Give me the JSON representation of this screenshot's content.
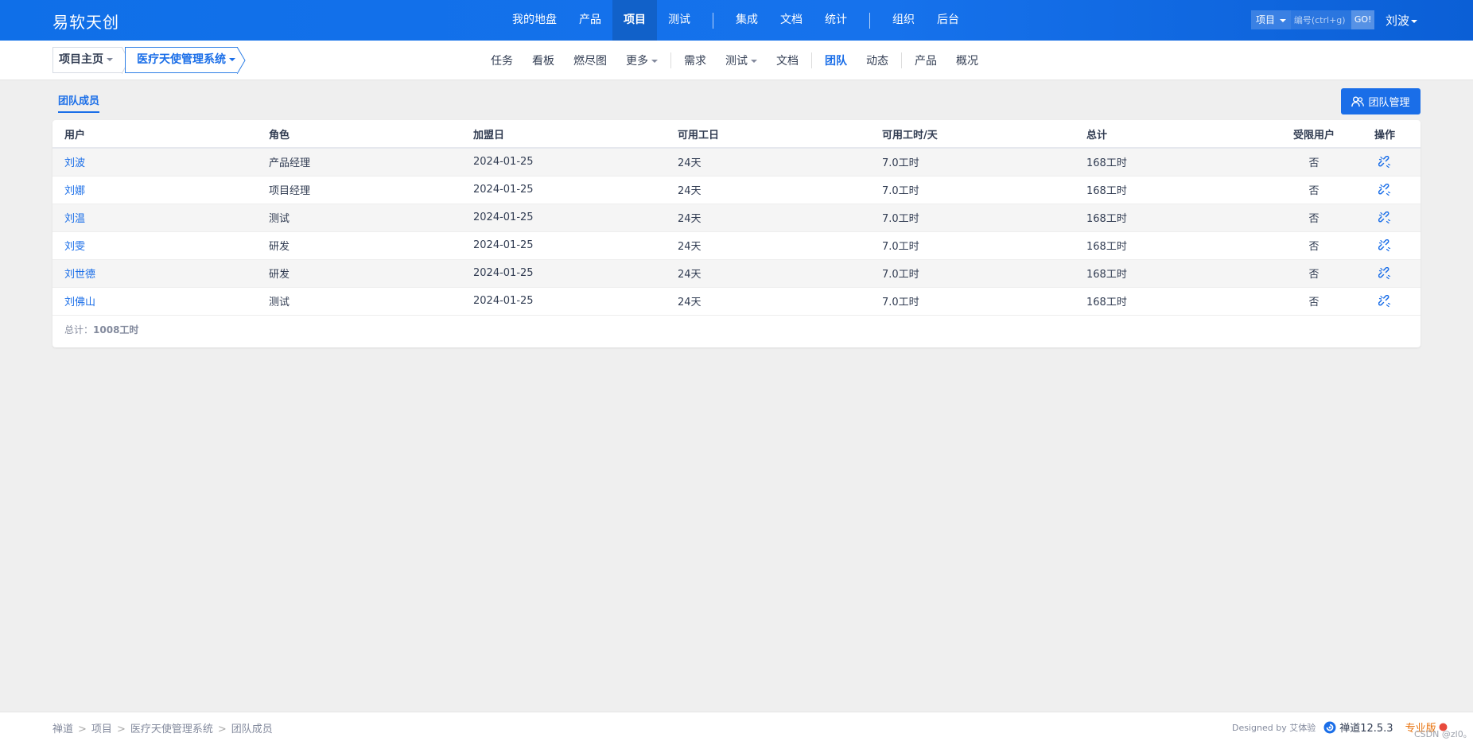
{
  "colors": {
    "brand": "#1672ec",
    "link": "#1a6ee8",
    "pro": "#e8720c"
  },
  "header": {
    "brand": "易软天创",
    "nav": [
      {
        "label": "我的地盘",
        "active": false
      },
      {
        "label": "产品",
        "active": false
      },
      {
        "label": "项目",
        "active": true
      },
      {
        "label": "测试",
        "active": false
      },
      {
        "label": "集成",
        "active": false
      },
      {
        "label": "文档",
        "active": false
      },
      {
        "label": "统计",
        "active": false
      },
      {
        "label": "组织",
        "active": false
      },
      {
        "label": "后台",
        "active": false
      }
    ],
    "search": {
      "type": "项目",
      "placeholder": "编号(ctrl+g)",
      "go": "GO!"
    },
    "user": "刘波"
  },
  "subheader": {
    "crumb_home": "项目主页",
    "crumb_project": "医疗天使管理系统",
    "nav": [
      {
        "label": "任务",
        "active": false
      },
      {
        "label": "看板",
        "active": false
      },
      {
        "label": "燃尽图",
        "active": false
      },
      {
        "label": "更多",
        "active": false
      },
      {
        "label": "需求",
        "active": false
      },
      {
        "label": "测试",
        "active": false
      },
      {
        "label": "文档",
        "active": false
      },
      {
        "label": "团队",
        "active": true
      },
      {
        "label": "动态",
        "active": false
      },
      {
        "label": "产品",
        "active": false
      },
      {
        "label": "概况",
        "active": false
      }
    ]
  },
  "main": {
    "tab": "团队成员",
    "manage_button": "团队管理",
    "table": {
      "headers": [
        "用户",
        "角色",
        "加盟日",
        "可用工日",
        "可用工时/天",
        "总计",
        "受限用户",
        "操作"
      ],
      "rows": [
        {
          "user": "刘波",
          "role": "产品经理",
          "join": "2024-01-25",
          "days": "24天",
          "hours": "7.0工时",
          "total": "168工时",
          "limited": "否"
        },
        {
          "user": "刘娜",
          "role": "项目经理",
          "join": "2024-01-25",
          "days": "24天",
          "hours": "7.0工时",
          "total": "168工时",
          "limited": "否"
        },
        {
          "user": "刘温",
          "role": "测试",
          "join": "2024-01-25",
          "days": "24天",
          "hours": "7.0工时",
          "total": "168工时",
          "limited": "否"
        },
        {
          "user": "刘雯",
          "role": "研发",
          "join": "2024-01-25",
          "days": "24天",
          "hours": "7.0工时",
          "total": "168工时",
          "limited": "否"
        },
        {
          "user": "刘世德",
          "role": "研发",
          "join": "2024-01-25",
          "days": "24天",
          "hours": "7.0工时",
          "total": "168工时",
          "limited": "否"
        },
        {
          "user": "刘佛山",
          "role": "测试",
          "join": "2024-01-25",
          "days": "24天",
          "hours": "7.0工时",
          "total": "168工时",
          "limited": "否"
        }
      ],
      "row_action_icon": "unlink-icon"
    },
    "summary_label": "总计：",
    "summary_value": "1008工时"
  },
  "footer": {
    "crumbs": [
      "禅道",
      "项目",
      "医疗天使管理系统",
      "团队成员"
    ],
    "designed": "Designed by 艾体验",
    "version": "禅道12.5.3",
    "pro": "专业版",
    "watermark": "CSDN @zl0。"
  }
}
